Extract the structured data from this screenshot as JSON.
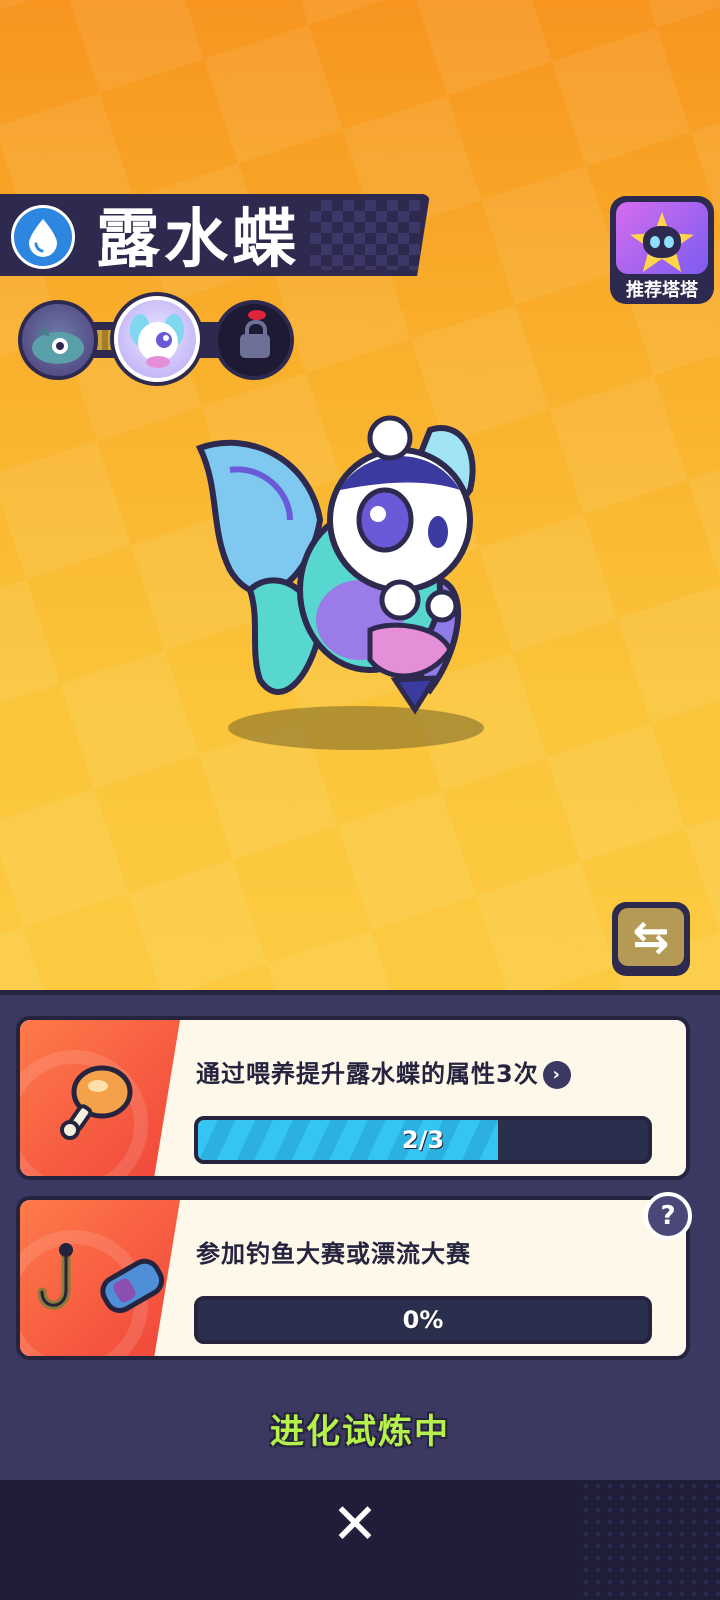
{
  "pet": {
    "name": "露水蝶",
    "element_icon": "water-drop-icon"
  },
  "header": {
    "recommend_label": "推荐塔塔"
  },
  "evolution_stages": [
    {
      "name": "stage-1",
      "state": "past"
    },
    {
      "name": "stage-2",
      "state": "current"
    },
    {
      "name": "stage-3",
      "state": "locked"
    }
  ],
  "tasks": [
    {
      "text": "通过喂养提升露水蝶的属性3次",
      "progress_label": "2/3",
      "progress": 0.667,
      "icon": "meat-drumstick-icon"
    },
    {
      "text": "参加钓鱼大赛或漂流大赛",
      "progress_label": "0%",
      "progress": 0,
      "icon": "fishing-hook-icon"
    }
  ],
  "status": {
    "label": "进化试炼中"
  },
  "colors": {
    "accent_green": "#b6f04a",
    "progress_blue": "#34c5f0",
    "panel": "#3b3862"
  }
}
